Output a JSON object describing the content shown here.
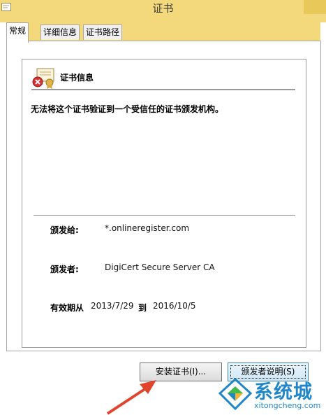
{
  "window": {
    "title": "证书"
  },
  "tabs": [
    {
      "label": "常规",
      "active": true
    },
    {
      "label": "详细信息",
      "active": false
    },
    {
      "label": "证书路径",
      "active": false
    }
  ],
  "cert_info": {
    "title": "证书信息",
    "warning": "无法将这个证书验证到一个受信任的证书颁发机构。"
  },
  "fields": {
    "issued_to_label": "颁发给:",
    "issued_to_value": "*.onlineregister.com",
    "issued_by_label": "颁发者:",
    "issued_by_value": "DigiCert Secure Server CA",
    "valid_label": "有效期从",
    "valid_from": "2013/7/29",
    "valid_to_word": "到",
    "valid_to": "2016/10/5"
  },
  "buttons": {
    "install_label": "安装证书(I)...",
    "issuer_statement_label": "颁发者说明(S)"
  },
  "watermark": {
    "name": "系统城",
    "url": "xitongcheng.com"
  },
  "colors": {
    "titlebar": "#f3d97b",
    "watermark": "#1f87c9",
    "arrow": "#e0452c"
  },
  "icons": [
    "certificate-error-icon",
    "window-icon",
    "annotation-arrow-icon",
    "watermark-logo-icon"
  ]
}
